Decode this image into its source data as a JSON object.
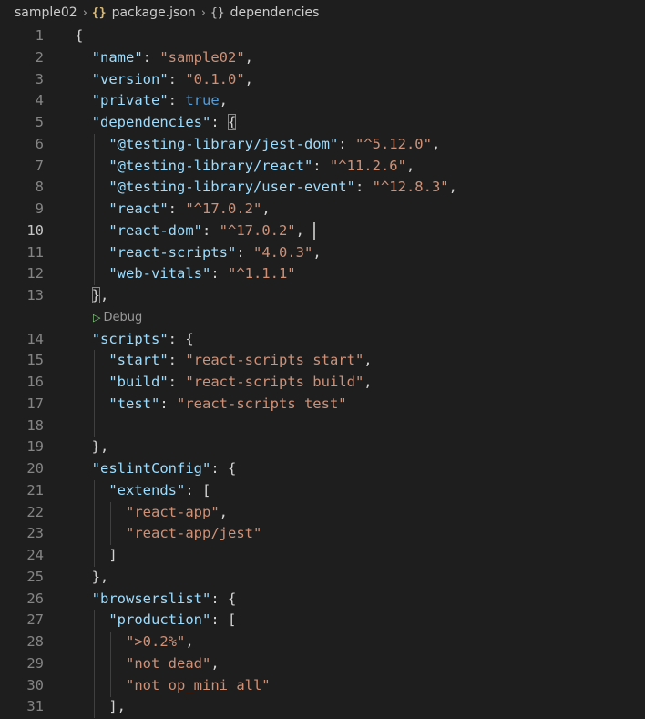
{
  "breadcrumb": {
    "folder": "sample02",
    "file_icon": "json-braces-icon",
    "file": "package.json",
    "symbol_icon": "object-braces-icon",
    "symbol": "dependencies",
    "separator": "›"
  },
  "codelens": {
    "label": "Debug",
    "icon": "play-icon"
  },
  "active_line": "10",
  "lines": [
    {
      "n": "1",
      "tokens": [
        {
          "t": "{",
          "c": "p"
        }
      ]
    },
    {
      "n": "2",
      "tokens": [
        {
          "t": "  ",
          "c": "p"
        },
        {
          "t": "\"name\"",
          "c": "k"
        },
        {
          "t": ": ",
          "c": "p"
        },
        {
          "t": "\"sample02\"",
          "c": "s"
        },
        {
          "t": ",",
          "c": "p"
        }
      ]
    },
    {
      "n": "3",
      "tokens": [
        {
          "t": "  ",
          "c": "p"
        },
        {
          "t": "\"version\"",
          "c": "k"
        },
        {
          "t": ": ",
          "c": "p"
        },
        {
          "t": "\"0.1.0\"",
          "c": "s"
        },
        {
          "t": ",",
          "c": "p"
        }
      ]
    },
    {
      "n": "4",
      "tokens": [
        {
          "t": "  ",
          "c": "p"
        },
        {
          "t": "\"private\"",
          "c": "k"
        },
        {
          "t": ": ",
          "c": "p"
        },
        {
          "t": "true",
          "c": "b"
        },
        {
          "t": ",",
          "c": "p"
        }
      ]
    },
    {
      "n": "5",
      "tokens": [
        {
          "t": "  ",
          "c": "p"
        },
        {
          "t": "\"dependencies\"",
          "c": "k"
        },
        {
          "t": ": ",
          "c": "p"
        },
        {
          "t": "{",
          "c": "p",
          "match": true
        }
      ]
    },
    {
      "n": "6",
      "tokens": [
        {
          "t": "    ",
          "c": "p"
        },
        {
          "t": "\"@testing-library/jest-dom\"",
          "c": "k"
        },
        {
          "t": ": ",
          "c": "p"
        },
        {
          "t": "\"^5.12.0\"",
          "c": "s"
        },
        {
          "t": ",",
          "c": "p"
        }
      ]
    },
    {
      "n": "7",
      "tokens": [
        {
          "t": "    ",
          "c": "p"
        },
        {
          "t": "\"@testing-library/react\"",
          "c": "k"
        },
        {
          "t": ": ",
          "c": "p"
        },
        {
          "t": "\"^11.2.6\"",
          "c": "s"
        },
        {
          "t": ",",
          "c": "p"
        }
      ]
    },
    {
      "n": "8",
      "tokens": [
        {
          "t": "    ",
          "c": "p"
        },
        {
          "t": "\"@testing-library/user-event\"",
          "c": "k"
        },
        {
          "t": ": ",
          "c": "p"
        },
        {
          "t": "\"^12.8.3\"",
          "c": "s"
        },
        {
          "t": ",",
          "c": "p"
        }
      ]
    },
    {
      "n": "9",
      "tokens": [
        {
          "t": "    ",
          "c": "p"
        },
        {
          "t": "\"react\"",
          "c": "k"
        },
        {
          "t": ": ",
          "c": "p"
        },
        {
          "t": "\"^17.0.2\"",
          "c": "s"
        },
        {
          "t": ",",
          "c": "p"
        }
      ]
    },
    {
      "n": "10",
      "tokens": [
        {
          "t": "    ",
          "c": "p"
        },
        {
          "t": "\"react-dom\"",
          "c": "k"
        },
        {
          "t": ": ",
          "c": "p"
        },
        {
          "t": "\"^17.0.2\"",
          "c": "s"
        },
        {
          "t": ",",
          "c": "p"
        }
      ],
      "cursor": true
    },
    {
      "n": "11",
      "tokens": [
        {
          "t": "    ",
          "c": "p"
        },
        {
          "t": "\"react-scripts\"",
          "c": "k"
        },
        {
          "t": ": ",
          "c": "p"
        },
        {
          "t": "\"4.0.3\"",
          "c": "s"
        },
        {
          "t": ",",
          "c": "p"
        }
      ]
    },
    {
      "n": "12",
      "tokens": [
        {
          "t": "    ",
          "c": "p"
        },
        {
          "t": "\"web-vitals\"",
          "c": "k"
        },
        {
          "t": ": ",
          "c": "p"
        },
        {
          "t": "\"^1.1.1\"",
          "c": "s"
        }
      ]
    },
    {
      "n": "13",
      "tokens": [
        {
          "t": "  ",
          "c": "p"
        },
        {
          "t": "}",
          "c": "p",
          "match": true
        },
        {
          "t": ",",
          "c": "p"
        }
      ]
    },
    {
      "codelens": true
    },
    {
      "n": "14",
      "tokens": [
        {
          "t": "  ",
          "c": "p"
        },
        {
          "t": "\"scripts\"",
          "c": "k"
        },
        {
          "t": ": ",
          "c": "p"
        },
        {
          "t": "{",
          "c": "p"
        }
      ]
    },
    {
      "n": "15",
      "tokens": [
        {
          "t": "    ",
          "c": "p"
        },
        {
          "t": "\"start\"",
          "c": "k"
        },
        {
          "t": ": ",
          "c": "p"
        },
        {
          "t": "\"react-scripts start\"",
          "c": "s"
        },
        {
          "t": ",",
          "c": "p"
        }
      ]
    },
    {
      "n": "16",
      "tokens": [
        {
          "t": "    ",
          "c": "p"
        },
        {
          "t": "\"build\"",
          "c": "k"
        },
        {
          "t": ": ",
          "c": "p"
        },
        {
          "t": "\"react-scripts build\"",
          "c": "s"
        },
        {
          "t": ",",
          "c": "p"
        }
      ]
    },
    {
      "n": "17",
      "tokens": [
        {
          "t": "    ",
          "c": "p"
        },
        {
          "t": "\"test\"",
          "c": "k"
        },
        {
          "t": ": ",
          "c": "p"
        },
        {
          "t": "\"react-scripts test\"",
          "c": "s"
        }
      ]
    },
    {
      "n": "18",
      "tokens": []
    },
    {
      "n": "19",
      "tokens": [
        {
          "t": "  ",
          "c": "p"
        },
        {
          "t": "},",
          "c": "p"
        }
      ]
    },
    {
      "n": "20",
      "tokens": [
        {
          "t": "  ",
          "c": "p"
        },
        {
          "t": "\"eslintConfig\"",
          "c": "k"
        },
        {
          "t": ": ",
          "c": "p"
        },
        {
          "t": "{",
          "c": "p"
        }
      ]
    },
    {
      "n": "21",
      "tokens": [
        {
          "t": "    ",
          "c": "p"
        },
        {
          "t": "\"extends\"",
          "c": "k"
        },
        {
          "t": ": ",
          "c": "p"
        },
        {
          "t": "[",
          "c": "p"
        }
      ]
    },
    {
      "n": "22",
      "tokens": [
        {
          "t": "      ",
          "c": "p"
        },
        {
          "t": "\"react-app\"",
          "c": "s"
        },
        {
          "t": ",",
          "c": "p"
        }
      ]
    },
    {
      "n": "23",
      "tokens": [
        {
          "t": "      ",
          "c": "p"
        },
        {
          "t": "\"react-app/jest\"",
          "c": "s"
        }
      ]
    },
    {
      "n": "24",
      "tokens": [
        {
          "t": "    ",
          "c": "p"
        },
        {
          "t": "]",
          "c": "p"
        }
      ]
    },
    {
      "n": "25",
      "tokens": [
        {
          "t": "  ",
          "c": "p"
        },
        {
          "t": "},",
          "c": "p"
        }
      ]
    },
    {
      "n": "26",
      "tokens": [
        {
          "t": "  ",
          "c": "p"
        },
        {
          "t": "\"browserslist\"",
          "c": "k"
        },
        {
          "t": ": ",
          "c": "p"
        },
        {
          "t": "{",
          "c": "p"
        }
      ]
    },
    {
      "n": "27",
      "tokens": [
        {
          "t": "    ",
          "c": "p"
        },
        {
          "t": "\"production\"",
          "c": "k"
        },
        {
          "t": ": ",
          "c": "p"
        },
        {
          "t": "[",
          "c": "p"
        }
      ]
    },
    {
      "n": "28",
      "tokens": [
        {
          "t": "      ",
          "c": "p"
        },
        {
          "t": "\">0.2%\"",
          "c": "s"
        },
        {
          "t": ",",
          "c": "p"
        }
      ]
    },
    {
      "n": "29",
      "tokens": [
        {
          "t": "      ",
          "c": "p"
        },
        {
          "t": "\"not dead\"",
          "c": "s"
        },
        {
          "t": ",",
          "c": "p"
        }
      ]
    },
    {
      "n": "30",
      "tokens": [
        {
          "t": "      ",
          "c": "p"
        },
        {
          "t": "\"not op_mini all\"",
          "c": "s"
        }
      ]
    },
    {
      "n": "31",
      "tokens": [
        {
          "t": "    ",
          "c": "p"
        },
        {
          "t": "],",
          "c": "p"
        }
      ]
    }
  ]
}
